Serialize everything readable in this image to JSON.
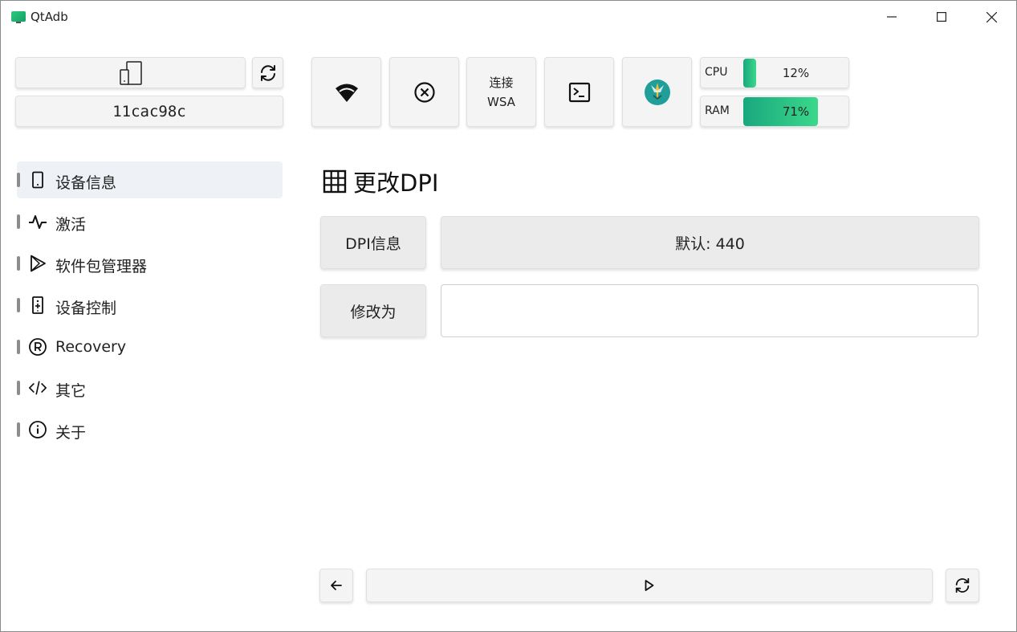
{
  "window": {
    "title": "QtAdb"
  },
  "device": {
    "serial": "11cac98c"
  },
  "toolbar": {
    "wsa_line1": "连接",
    "wsa_line2": "WSA",
    "icons": [
      "wifi-icon",
      "disconnect-icon",
      "connect-wsa",
      "terminal-icon",
      "magisk-icon"
    ]
  },
  "stats": {
    "cpu": {
      "label": "CPU",
      "value": "12%",
      "fraction": 0.12
    },
    "ram": {
      "label": "RAM",
      "value": "71%",
      "fraction": 0.71
    }
  },
  "sidebar": {
    "items": [
      {
        "label": "设备信息",
        "icon": "phone-icon",
        "active": true
      },
      {
        "label": "激活",
        "icon": "activity-icon",
        "active": false
      },
      {
        "label": "软件包管理器",
        "icon": "play-store-icon",
        "active": false
      },
      {
        "label": "设备控制",
        "icon": "remote-icon",
        "active": false
      },
      {
        "label": "Recovery",
        "icon": "registered-icon",
        "active": false
      },
      {
        "label": "其它",
        "icon": "code-icon",
        "active": false
      },
      {
        "label": "关于",
        "icon": "info-icon",
        "active": false
      }
    ]
  },
  "page": {
    "title": "更改DPI",
    "dpi_info_label": "DPI信息",
    "dpi_info_value": "默认: 440",
    "modify_label": "修改为",
    "modify_value": "",
    "modify_placeholder": ""
  },
  "colors": {
    "accent_start": "#19a77e",
    "accent_end": "#3bd88b",
    "active_nav_bg": "#eef1f6"
  }
}
